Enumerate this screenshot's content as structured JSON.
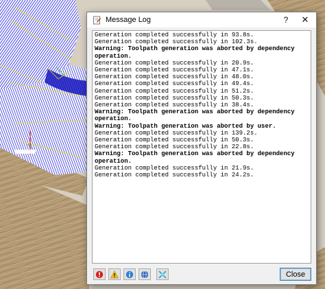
{
  "dialog": {
    "title": "Message Log",
    "help_label": "?",
    "close_glyph": "✕",
    "close_button_label": "Close"
  },
  "log": {
    "lines": [
      {
        "text": "Generation completed successfully in 93.8s.",
        "type": "info"
      },
      {
        "text": "Generation completed successfully in 102.3s.",
        "type": "info"
      },
      {
        "text": "Warning: Toolpath generation was aborted by dependency",
        "type": "warning"
      },
      {
        "text": "operation.",
        "type": "warning"
      },
      {
        "text": "Generation completed successfully in 20.9s.",
        "type": "info"
      },
      {
        "text": "Generation completed successfully in 47.1s.",
        "type": "info"
      },
      {
        "text": "Generation completed successfully in 48.0s.",
        "type": "info"
      },
      {
        "text": "Generation completed successfully in 49.4s.",
        "type": "info"
      },
      {
        "text": "Generation completed successfully in 51.2s.",
        "type": "info"
      },
      {
        "text": "Generation completed successfully in 50.3s.",
        "type": "info"
      },
      {
        "text": "Generation completed successfully in 38.4s.",
        "type": "info"
      },
      {
        "text": "Warning: Toolpath generation was aborted by dependency",
        "type": "warning"
      },
      {
        "text": "operation.",
        "type": "warning"
      },
      {
        "text": "Warning: Toolpath generation was aborted by user.",
        "type": "warning"
      },
      {
        "text": "Generation completed successfully in 139.2s.",
        "type": "info"
      },
      {
        "text": "Generation completed successfully in 50.3s.",
        "type": "info"
      },
      {
        "text": "Generation completed successfully in 22.8s.",
        "type": "info"
      },
      {
        "text": "Warning: Toolpath generation was aborted by dependency",
        "type": "warning"
      },
      {
        "text": "operation.",
        "type": "warning"
      },
      {
        "text": "Generation completed successfully in 21.9s.",
        "type": "info"
      },
      {
        "text": "Generation completed successfully in 24.2s.",
        "type": "info"
      }
    ]
  },
  "filters": [
    {
      "name": "filter-errors-button",
      "icon": "error-icon",
      "color": "#d42020"
    },
    {
      "name": "filter-warnings-button",
      "icon": "warning-icon",
      "color": "#f0c419"
    },
    {
      "name": "filter-info-button",
      "icon": "info-icon",
      "color": "#2f7fd6"
    },
    {
      "name": "filter-debug-button",
      "icon": "globe-icon",
      "color": "#2a62b8"
    },
    {
      "name": "clear-log-button",
      "icon": "clear-icon",
      "color": "#2aa6c8"
    }
  ],
  "colors": {
    "toolpath_blue": "#1010ee",
    "toolpath_yellow": "#e8e000",
    "wood": "#b39a74"
  }
}
